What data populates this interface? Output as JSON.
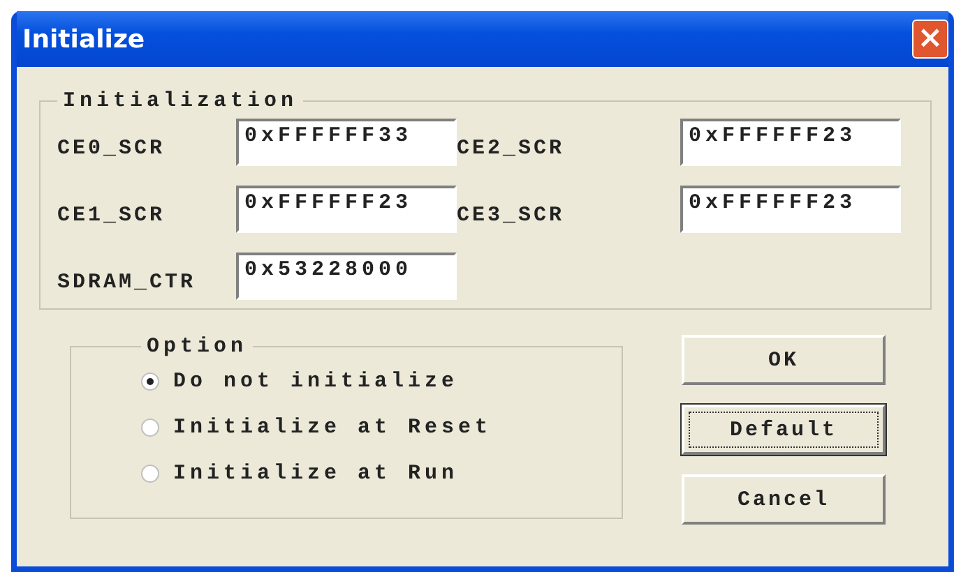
{
  "window": {
    "title": "Initialize",
    "close": "×"
  },
  "initialization": {
    "title": "Initialization",
    "fields": [
      {
        "label": "CE0_SCR",
        "value": "0xFFFFFF33"
      },
      {
        "label": "CE2_SCR",
        "value": "0xFFFFFF23"
      },
      {
        "label": "CE1_SCR",
        "value": "0xFFFFFF23"
      },
      {
        "label": "CE3_SCR",
        "value": "0xFFFFFF23"
      },
      {
        "label": "SDRAM_CTR",
        "value": "0x53228000"
      }
    ]
  },
  "option": {
    "title": "Option",
    "choices": [
      {
        "label": "Do not initialize",
        "selected": true
      },
      {
        "label": "Initialize at Reset",
        "selected": false
      },
      {
        "label": "Initialize at Run",
        "selected": false
      }
    ]
  },
  "buttons": [
    {
      "label": "OK",
      "focused": false
    },
    {
      "label": "Default",
      "focused": true
    },
    {
      "label": "Cancel",
      "focused": false
    }
  ]
}
